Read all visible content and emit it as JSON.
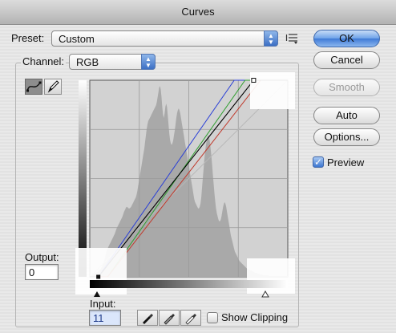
{
  "window": {
    "title": "Curves"
  },
  "preset": {
    "label": "Preset:",
    "value": "Custom"
  },
  "channel": {
    "label": "Channel:",
    "value": "RGB"
  },
  "buttons": {
    "ok": "OK",
    "cancel": "Cancel",
    "smooth": "Smooth",
    "auto": "Auto",
    "options": "Options..."
  },
  "preview": {
    "label": "Preview",
    "checked": true
  },
  "output": {
    "label": "Output:",
    "value": "0"
  },
  "input": {
    "label": "Input:",
    "value": "11"
  },
  "show_clipping": {
    "label": "Show Clipping",
    "checked": false
  },
  "icons": {
    "curve_tool": "curve-icon",
    "pencil_tool": "pencil-icon",
    "preset_menu": "preset-options-icon",
    "black_eyedropper": "eyedropper-black-icon",
    "gray_eyedropper": "eyedropper-gray-icon",
    "white_eyedropper": "eyedropper-white-icon"
  },
  "colors": {
    "curve_rgb": "#000000",
    "curve_red": "#c0392b",
    "curve_green": "#2f9e2f",
    "curve_blue": "#2a3fd6",
    "histogram": "#a9a9a9",
    "accent": "#3f7ad6"
  },
  "curves": {
    "rgb": [
      [
        11,
        0
      ],
      [
        211,
        255
      ]
    ],
    "red": [
      [
        23,
        0
      ],
      [
        220,
        255
      ]
    ],
    "green": [
      [
        23,
        0
      ],
      [
        200,
        255
      ]
    ],
    "blue": [
      [
        11,
        0
      ],
      [
        186,
        255
      ]
    ],
    "baseline": [
      [
        0,
        0
      ],
      [
        255,
        255
      ]
    ]
  },
  "histogram": [
    2,
    2,
    3,
    3,
    3,
    4,
    4,
    5,
    5,
    6,
    6,
    7,
    8,
    9,
    10,
    12,
    14,
    16,
    19,
    22,
    26,
    30,
    34,
    36,
    38,
    40,
    42,
    44,
    46,
    48,
    50,
    52,
    54,
    57,
    60,
    62,
    64,
    66,
    68,
    70,
    72,
    74,
    76,
    79,
    82,
    84,
    86,
    88,
    88,
    87,
    86,
    86,
    87,
    88,
    90,
    92,
    94,
    96,
    98,
    100,
    103,
    108,
    114,
    120,
    126,
    132,
    138,
    144,
    150,
    156,
    162,
    170,
    178,
    186,
    192,
    196,
    198,
    200,
    202,
    204,
    206,
    208,
    210,
    212,
    214,
    216,
    220,
    226,
    232,
    238,
    240,
    236,
    226,
    214,
    204,
    200,
    206,
    214,
    218,
    214,
    204,
    192,
    180,
    172,
    168,
    166,
    168,
    172,
    178,
    184,
    192,
    200,
    206,
    210,
    212,
    210,
    206,
    200,
    194,
    188,
    182,
    176,
    170,
    164,
    158,
    152,
    146,
    140,
    134,
    128,
    122,
    116,
    110,
    104,
    98,
    94,
    92,
    90,
    88,
    86,
    86,
    88,
    92,
    100,
    112,
    124,
    136,
    148,
    158,
    166,
    172,
    176,
    178,
    176,
    170,
    162,
    152,
    140,
    128,
    116,
    104,
    94,
    86,
    80,
    76,
    72,
    70,
    70,
    72,
    76,
    82,
    88,
    92,
    94,
    92,
    88,
    82,
    76,
    70,
    64,
    58,
    52,
    48,
    44,
    40,
    36,
    32,
    30,
    28,
    26,
    24,
    22,
    20,
    19,
    18,
    17,
    16,
    15,
    14,
    13,
    12,
    11,
    10,
    10,
    9,
    9,
    8,
    8,
    7,
    7,
    6,
    6,
    5,
    5,
    5,
    4,
    4,
    4,
    3,
    3,
    3,
    3,
    2,
    2,
    2,
    2,
    2,
    2,
    2,
    2,
    1,
    1,
    1,
    1,
    1,
    1,
    1,
    1,
    1,
    1,
    1,
    1,
    1,
    1,
    1,
    1,
    1,
    1,
    1,
    1,
    1,
    1,
    1,
    1,
    1
  ],
  "points": {
    "black": [
      11,
      0
    ],
    "white": [
      211,
      255
    ]
  }
}
